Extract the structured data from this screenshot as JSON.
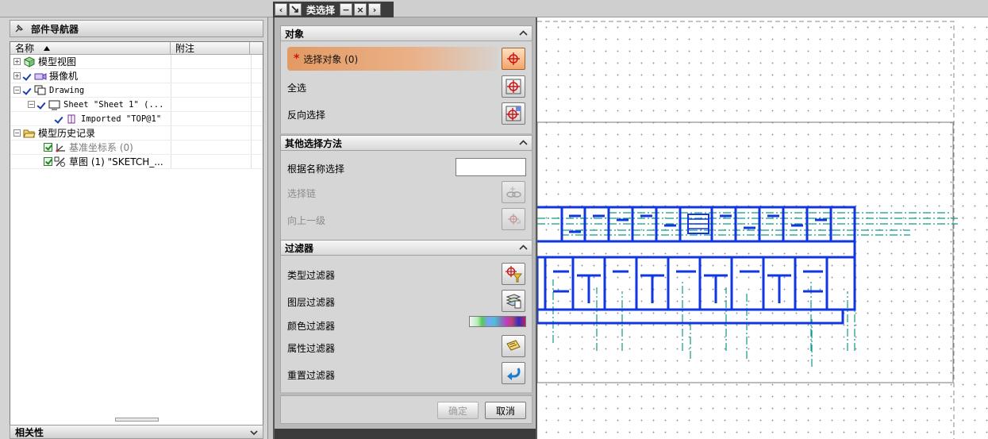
{
  "navigator": {
    "title": "部件导航器",
    "columns": {
      "name": "名称",
      "note": "附注"
    },
    "items": [
      {
        "label": "模型视图",
        "indent": 0
      },
      {
        "label": "摄像机",
        "indent": 0
      },
      {
        "label": "Drawing",
        "indent": 0
      },
      {
        "label": "Sheet \"Sheet 1\" (...",
        "indent": 1
      },
      {
        "label": "Imported \"TOP@1\"",
        "indent": 2
      },
      {
        "label": "模型历史记录",
        "indent": 0
      },
      {
        "label": "基准坐标系 (0)",
        "indent": 1
      },
      {
        "label": "草图 (1) \"SKETCH_...",
        "indent": 1
      }
    ],
    "related_panel": "相关性"
  },
  "dialog": {
    "title": "类选择",
    "sections": {
      "object": {
        "title": "对象",
        "select_object": "选择对象 (0)",
        "select_all": "全选",
        "invert_selection": "反向选择"
      },
      "other": {
        "title": "其他选择方法",
        "select_by_name": "根据名称选择",
        "name_value": "",
        "select_chain": "选择链",
        "up_one_level": "向上一级"
      },
      "filter": {
        "title": "过滤器",
        "type_filter": "类型过滤器",
        "layer_filter": "图层过滤器",
        "color_filter": "颜色过滤器",
        "attribute_filter": "属性过滤器",
        "reset_filter": "重置过滤器"
      }
    },
    "ok_label": "确定",
    "cancel_label": "取消"
  },
  "colors": {
    "drawing_lines": "#1036e0",
    "center_lines": "#0f9a8c",
    "sheet_border": "#7a7a7a"
  }
}
